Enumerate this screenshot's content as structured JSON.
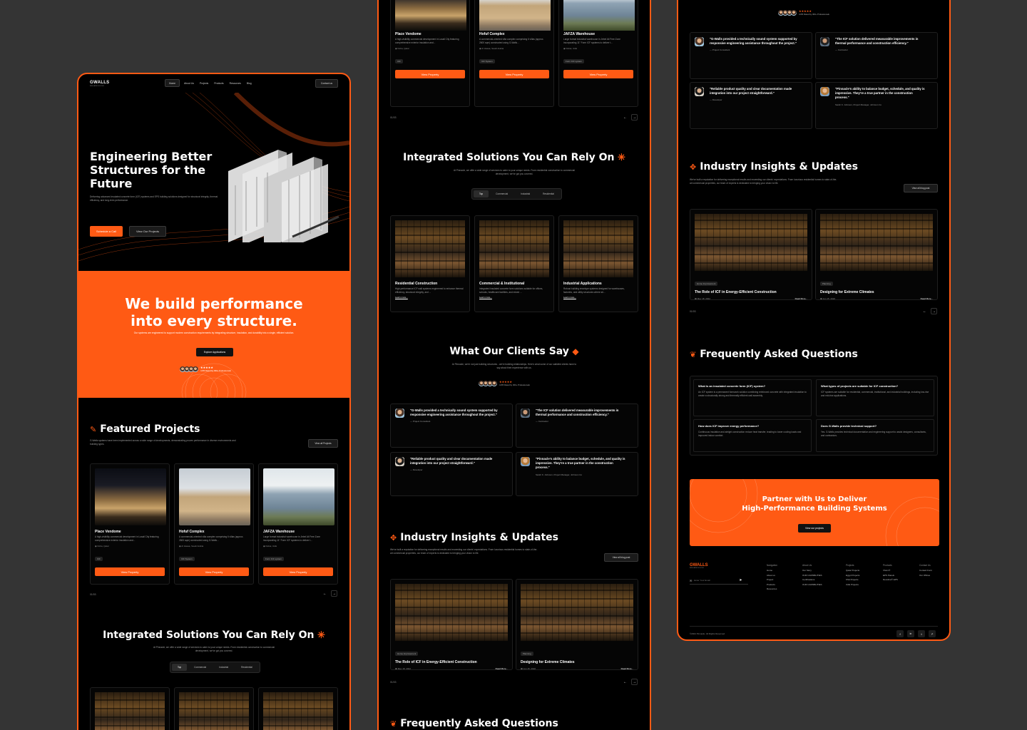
{
  "brand": {
    "logo": "GWALLS",
    "tagline": "INSULATED BLOCKS"
  },
  "nav": {
    "items": [
      "Home",
      "About Us",
      "Projects",
      "Products",
      "Resources",
      "Blog"
    ],
    "contact": "Contact us"
  },
  "hero": {
    "title_l1": "Engineering Better",
    "title_l2": "Structures for the",
    "title_l3": "Future",
    "desc": "Delivering advanced insulated concrete form (ICF) systems and EPS building solutions designed for structural integrity, thermal efficiency, and long-term performance.",
    "cta_primary": "Schedule a Call",
    "cta_secondary": "View Our Projects"
  },
  "performance": {
    "title_l1": "We build performance",
    "title_l2": "into every structure.",
    "desc": "Our systems are engineered to support modern construction requirements by integrating structure, insulation, and durability into a single, efficient solution.",
    "cta": "Explore Applications",
    "rating_text": "4.8/5 Rated by 300+ Professionals"
  },
  "featured": {
    "title": "Featured Projects",
    "desc": "G-Walls systems have been implemented across a wide range of developments, demonstrating proven performance in diverse environments and building types.",
    "view_all": "View all Projects",
    "counter": "01/03",
    "projects": [
      {
        "name": "Place Vendome",
        "desc": "A high-visibility commercial development in Lusail City featuring comprehensive exterior insulation and...",
        "location": "Doha, Qatar",
        "tag": "ICF",
        "cta": "View Property"
      },
      {
        "name": "Hofuf Complex",
        "desc": "A commercial-oriented villa complex comprising 6 villas (approx. 2600 sqm) constructed using G-Walls...",
        "location": "Al Hasaa, Saudi Arabia",
        "tag": "ICF System",
        "cta": "View Property"
      },
      {
        "name": "JAFZA Warehouse",
        "desc": "Large format industrial warehouse in Jebel Ali Free Zone incorporating 11\" Form ICF systems to deliver t...",
        "location": "Dubai, UAE",
        "tag": "Form ICF system",
        "cta": "View Property"
      }
    ]
  },
  "solutions": {
    "title": "Integrated Solutions You Can Rely On",
    "desc": "At Pinnacle, we offer a wide range of services to cater to your unique needs. From residential construction to commercial development, we've got you covered.",
    "tabs": [
      "Top",
      "Commercial",
      "Industrial",
      "Residential"
    ],
    "cards": [
      {
        "name": "Residential Construction",
        "desc": "High-performance ICF wall systems engineered to enhance thermal efficiency, structural integrity, and ...",
        "cta": "Learn more..."
      },
      {
        "name": "Commercial & Institutional",
        "desc": "Integrated insulated concrete form solutions suitable for offices, schools, healthcare facilities, and mixed ...",
        "cta": "Learn more..."
      },
      {
        "name": "Industrial Applications",
        "desc": "Robust building envelope systems designed for warehouses, factories, and utility structures where str...",
        "cta": "Learn more..."
      }
    ]
  },
  "testimonials": {
    "title": "What Our Clients Say",
    "desc": "At Pinnacle, we're not just building structures - we're building relationships. Here's what some of our satisfied clients have to say about their experience with us.",
    "rating_text": "4.8/5 Rated by 300+ Professionals",
    "items": [
      {
        "quote": "\"G-Walls provided a technically sound system supported by responsive engineering assistance throughout the project.\"",
        "author": "— Project Consultant"
      },
      {
        "quote": "\"The ICF solution delivered measurable improvements in thermal performance and construction efficiency.\"",
        "author": "— Contractor"
      },
      {
        "quote": "\"Reliable product quality and clear documentation made integration into our project straightforward.\"",
        "author": "— Developer"
      },
      {
        "quote": "\"Pinnacle's ability to balance budget, schedule, and quality is impressive. They're a true partner in the construction process.\"",
        "author": "Sarah K. Johnson, Project Manager, Johnson Co"
      }
    ]
  },
  "insights": {
    "title": "Industry Insights & Updates",
    "desc": "We've built a reputation for delivering exceptional results and exceeding our clients' expectations. From luxurious residential homes to state-of-the-art commercial properties, our team of experts is dedicated to bringing your vision to life.",
    "view_all": "View all blog post",
    "counter": "01/03",
    "posts": [
      {
        "tag": "Home Improvement",
        "title": "The Role of ICF in Energy-Efficient Construction",
        "date": "May 18, 2022",
        "cta": "Read More..."
      },
      {
        "tag": "Planning",
        "title": "Designing for Extreme Climates",
        "date": "Jun 15, 2022",
        "cta": "Read More..."
      }
    ]
  },
  "faq": {
    "title": "Frequently Asked Questions",
    "items": [
      {
        "q": "What is an insulated concrete form (ICF) system?",
        "a": "An ICF system is a permanent formwork solution combining reinforced concrete with integrated insulation to create a structurally strong and thermally efficient wall assembly."
      },
      {
        "q": "What types of projects are suitable for ICF construction?",
        "a": "ICF systems are suitable for residential, commercial, institutional, and industrial buildings, including low-rise and mid-rise applications."
      },
      {
        "q": "How does ICF improve energy performance?",
        "a": "Continuous insulation and airtight construction reduce heat transfer, leading to lower cooling loads and improved indoor comfort."
      },
      {
        "q": "Does G-Walls provide technical support?",
        "a": "Yes. G-Walls provides technical documentation and engineering support to assist designers, consultants, and contractors."
      }
    ]
  },
  "cta_banner": {
    "title_l1": "Partner with Us to Deliver",
    "title_l2": "High-Performance Building Systems",
    "cta": "View our projects"
  },
  "footer": {
    "email_placeholder": "Enter Your Email",
    "cols": [
      {
        "head": "Navigation",
        "items": [
          "Home",
          "About us",
          "Project",
          "Products",
          "Resources"
        ]
      },
      {
        "head": "About Us",
        "items": [
          "Our Story",
          "OUR CAPABILITIES",
          "Certifications",
          "OUR CAPABILITIES"
        ]
      },
      {
        "head": "Projects",
        "items": [
          "Qatar Projects",
          "Egypt Projects",
          "KSA Projects",
          "UAE Projects"
        ]
      },
      {
        "head": "Products",
        "items": [
          "Vform®",
          "EPS Panels",
          "Decoline® EPS"
        ]
      },
      {
        "head": "Contact Us",
        "items": [
          "Contact Form",
          "Our Offices"
        ]
      }
    ],
    "copyright": "©2024 Pinnacle. All Rights Reserved",
    "social": [
      "f",
      "in",
      "t",
      "yt"
    ]
  },
  "colors": {
    "accent": "#ff5a14",
    "background": "#000000",
    "canvas": "#343434"
  }
}
